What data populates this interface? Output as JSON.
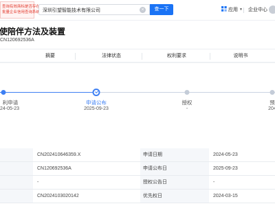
{
  "header": {
    "banner_line1": "查询有效商标是否存在",
    "banner_line2": "批量企业信用查询系统",
    "search_value": "深圳引望智能技术有限公司",
    "clear_icon": "clear-icon",
    "search_button": "查一下",
    "app_label": "应用",
    "enterprise_center": "企业中心",
    "user_icon": "avatar"
  },
  "patent": {
    "title": "陪伴方法及装置",
    "title_prefix": "使",
    "pub_no": "CN120692536A"
  },
  "tabs": [
    {
      "label": "摘要"
    },
    {
      "label": "法律状态"
    },
    {
      "label": "权利要求"
    },
    {
      "label": "说明书"
    }
  ],
  "timeline": [
    {
      "label": "利申请",
      "date": "24-05-23",
      "state": "done"
    },
    {
      "label": "申请公布",
      "date": "2025-09-23",
      "state": "current"
    },
    {
      "label": "授权",
      "date": "-",
      "state": "pending"
    },
    {
      "label": "预",
      "date": "204",
      "state": "pending"
    }
  ],
  "info_rows": [
    {
      "value1": "CN202410646359.X",
      "label2": "申请日期",
      "value2": "2024-05-23"
    },
    {
      "value1": "CN120692536A",
      "label2": "申请公布日",
      "value2": "2025-09-23"
    },
    {
      "value1": "-",
      "label2": "授权公告日",
      "value2": "-"
    },
    {
      "value1": "CN2024103020142",
      "label2": "优先权日",
      "value2": "2024-03-15"
    }
  ],
  "colors": {
    "accent": "#1a73f5",
    "timeline_active": "#3d7ff3",
    "banner_red": "#e23a2e"
  }
}
